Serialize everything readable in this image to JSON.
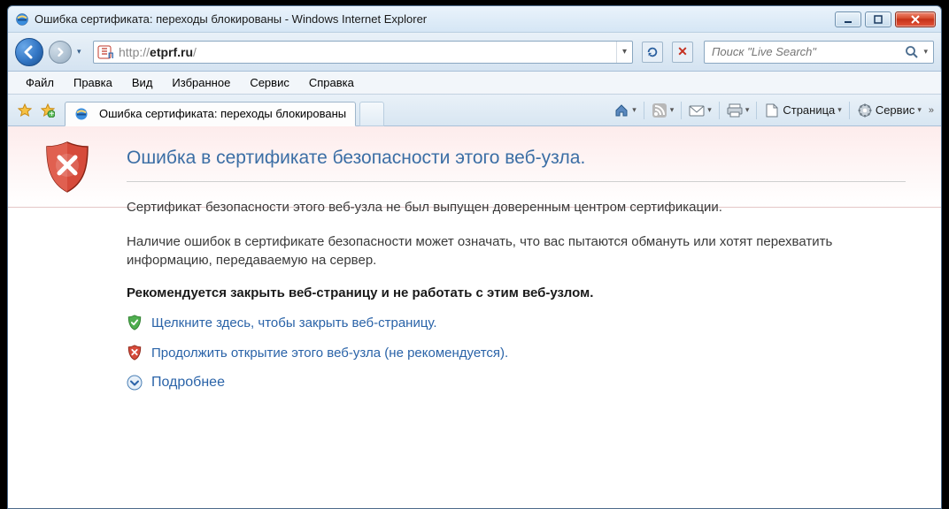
{
  "window": {
    "title": "Ошибка сертификата: переходы блокированы - Windows Internet Explorer"
  },
  "address": {
    "prefix": "http://",
    "host": "etprf.ru",
    "suffix": "/"
  },
  "search": {
    "placeholder": "Поиск \"Live Search\""
  },
  "menu": {
    "file": "Файл",
    "edit": "Правка",
    "view": "Вид",
    "fav": "Избранное",
    "tools": "Сервис",
    "help": "Справка"
  },
  "tab": {
    "label": "Ошибка сертификата: переходы блокированы"
  },
  "cmd": {
    "page": "Страница",
    "service": "Сервис"
  },
  "error": {
    "title": "Ошибка в сертификате безопасности этого веб-узла.",
    "para1": "Сертификат безопасности этого веб-узла не был выпущен доверенным центром сертификации.",
    "para2": "Наличие ошибок в сертификате безопасности может означать, что вас пытаются обмануть или хотят перехватить информацию, передаваемую на сервер.",
    "recommend": "Рекомендуется закрыть веб-страницу и не работать с этим веб-узлом.",
    "close_link": "Щелкните здесь, чтобы закрыть веб-страницу.",
    "continue_link": "Продолжить открытие этого веб-узла (не рекомендуется).",
    "more": "Подробнее"
  }
}
